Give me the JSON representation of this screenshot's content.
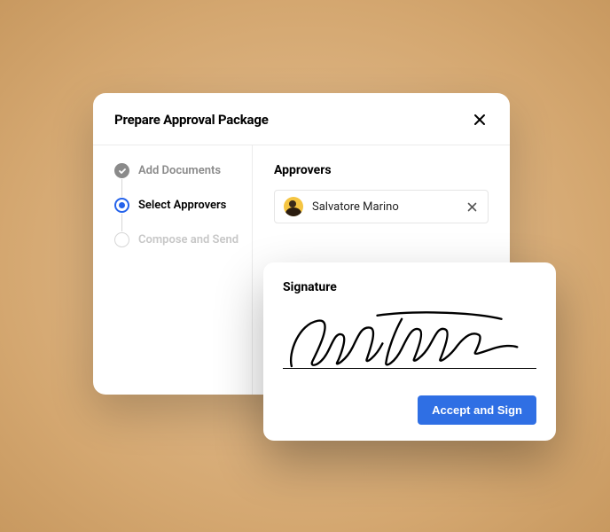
{
  "modal": {
    "title": "Prepare Approval Package",
    "steps": [
      {
        "label": "Add Documents",
        "state": "done"
      },
      {
        "label": "Select Approvers",
        "state": "active"
      },
      {
        "label": "Compose and Send",
        "state": "pending"
      }
    ]
  },
  "approvers": {
    "heading": "Approvers",
    "items": [
      {
        "name": "Salvatore Marino"
      }
    ]
  },
  "signature": {
    "heading": "Signature",
    "action_label": "Accept and Sign"
  },
  "colors": {
    "primary": "#2f6fe4",
    "step_active": "#2563eb"
  }
}
